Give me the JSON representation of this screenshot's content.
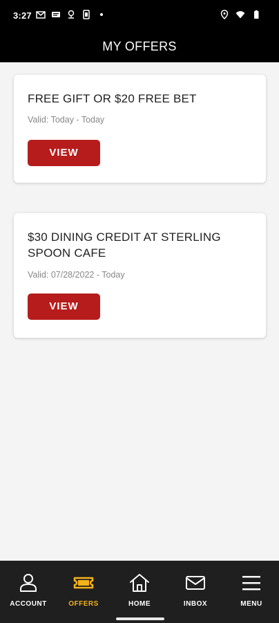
{
  "status_bar": {
    "time": "3:27",
    "left_icons": [
      "gmail-icon",
      "message-icon",
      "location-pin-icon",
      "sim-card-icon",
      "dot-icon"
    ],
    "right_icons": [
      "location-icon",
      "wifi-icon",
      "battery-icon"
    ]
  },
  "header": {
    "title": "MY OFFERS"
  },
  "offers": [
    {
      "title": "FREE GIFT OR $20 FREE BET",
      "valid": "Valid: Today - Today",
      "button_label": "VIEW"
    },
    {
      "title": "$30 DINING CREDIT AT STERLING SPOON CAFE",
      "valid": "Valid: 07/28/2022 - Today",
      "button_label": "VIEW"
    }
  ],
  "bottom_nav": {
    "active": "OFFERS",
    "items": [
      {
        "label": "ACCOUNT",
        "icon": "person-icon"
      },
      {
        "label": "OFFERS",
        "icon": "ticket-icon"
      },
      {
        "label": "HOME",
        "icon": "home-icon"
      },
      {
        "label": "INBOX",
        "icon": "mail-icon"
      },
      {
        "label": "MENU",
        "icon": "hamburger-icon"
      }
    ]
  },
  "colors": {
    "header_bg": "#000000",
    "button_red": "#b71c1c",
    "nav_bg": "#1f1f1f",
    "nav_active": "#f4b21a",
    "page_bg": "#f4f4f4"
  }
}
